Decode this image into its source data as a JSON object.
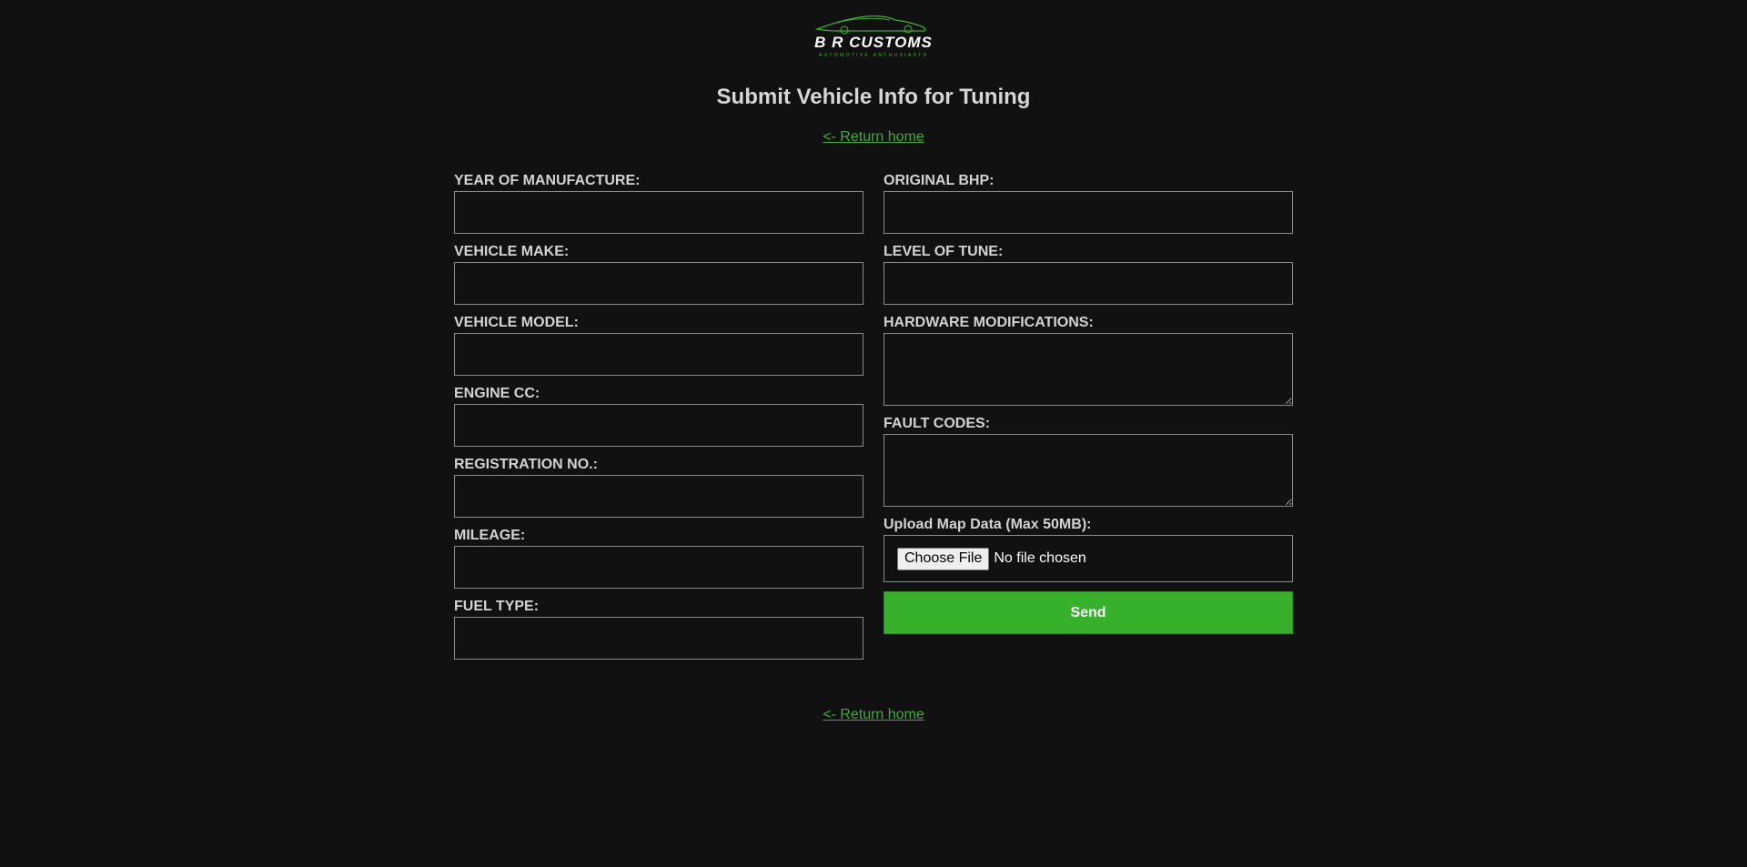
{
  "brand": {
    "name": "B R CUSTOMS",
    "tagline": "AUTOMOTIVE ENTHUSIASTS",
    "accent": "#37b02b",
    "logo_icon": "sports-car-outline-icon"
  },
  "page": {
    "title": "Submit Vehicle Info for Tuning",
    "return_link_top": "<- Return home",
    "return_link_bottom": "<- Return home"
  },
  "form": {
    "left_fields": [
      {
        "label": "YEAR OF MANUFACTURE:",
        "value": "",
        "placeholder": ""
      },
      {
        "label": "VEHICLE MAKE:",
        "value": "",
        "placeholder": ""
      },
      {
        "label": "VEHICLE MODEL:",
        "value": "",
        "placeholder": ""
      },
      {
        "label": "ENGINE CC:",
        "value": "",
        "placeholder": ""
      },
      {
        "label": "REGISTRATION NO.:",
        "value": "",
        "placeholder": ""
      },
      {
        "label": "MILEAGE:",
        "value": "",
        "placeholder": ""
      },
      {
        "label": "FUEL TYPE:",
        "value": "",
        "placeholder": ""
      }
    ],
    "right_fields": [
      {
        "label": "ORIGINAL BHP:",
        "value": "",
        "placeholder": ""
      },
      {
        "label": "LEVEL OF TUNE:",
        "value": "",
        "placeholder": ""
      }
    ],
    "textareas": [
      {
        "label": "HARDWARE MODIFICATIONS:",
        "value": ""
      },
      {
        "label": "FAULT CODES:",
        "value": ""
      }
    ],
    "upload": {
      "label": "Upload Map Data (Max 50MB):",
      "button_label": "Choose File",
      "status": "No file chosen"
    },
    "submit_label": "Send"
  }
}
